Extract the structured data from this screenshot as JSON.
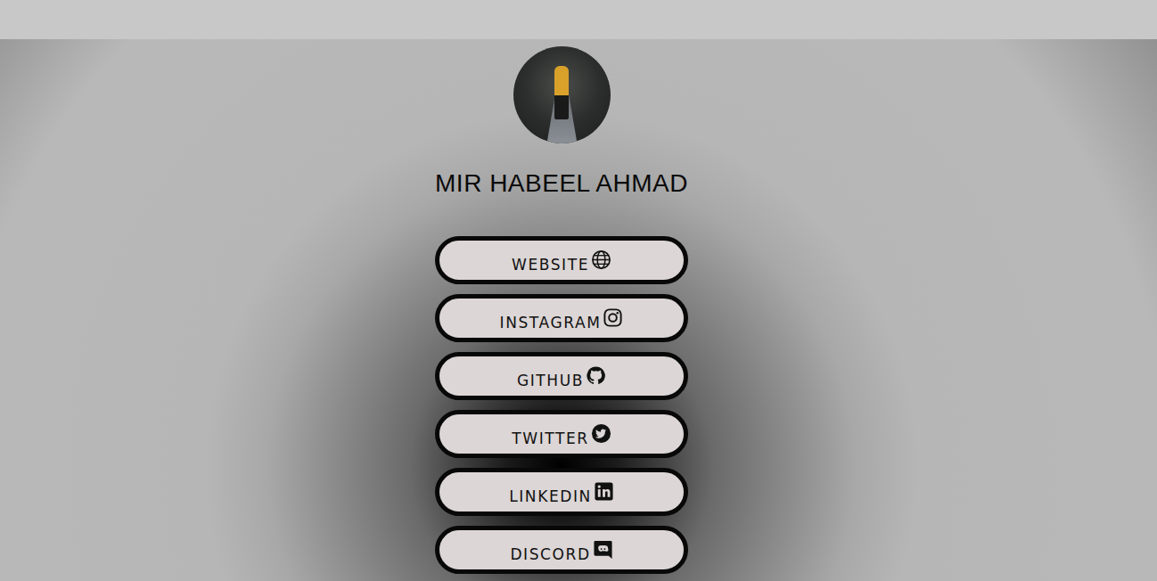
{
  "profile": {
    "name": "MIR HABEEL AHMAD"
  },
  "links": [
    {
      "label": "WEBSITE",
      "kind": "website"
    },
    {
      "label": "INSTAGRAM",
      "kind": "instagram"
    },
    {
      "label": "GITHUB",
      "kind": "github"
    },
    {
      "label": "TWITTER",
      "kind": "twitter"
    },
    {
      "label": "LINKEDIN",
      "kind": "linkedin"
    },
    {
      "label": "DISCORD",
      "kind": "discord"
    }
  ]
}
